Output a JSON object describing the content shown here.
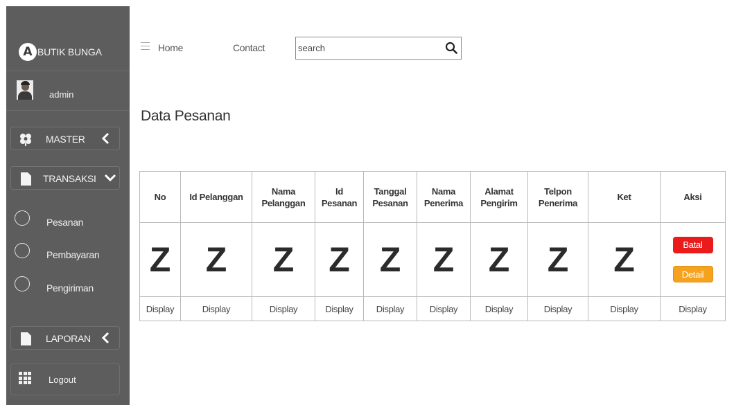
{
  "sidebar": {
    "brand": {
      "logo_letter": "A",
      "name": "BUTIK BUNGA"
    },
    "user": {
      "name": "admin"
    },
    "master": {
      "label": "MASTER"
    },
    "transaksi": {
      "label": "TRANSAKSI",
      "items": [
        {
          "label": "Pesanan"
        },
        {
          "label": "Pembayaran"
        },
        {
          "label": "Pengiriman"
        }
      ]
    },
    "laporan": {
      "label": "LAPORAN"
    },
    "logout": {
      "label": "Logout"
    }
  },
  "topnav": {
    "home": "Home",
    "contact": "Contact",
    "search_value": "search"
  },
  "page": {
    "title": "Data Pesanan"
  },
  "table": {
    "headers": [
      {
        "line1": "No",
        "line2": ""
      },
      {
        "line1": "Id Pelanggan",
        "line2": ""
      },
      {
        "line1": "Nama",
        "line2": "Pelanggan"
      },
      {
        "line1": "Id",
        "line2": "Pesanan"
      },
      {
        "line1": "Tanggal",
        "line2": "Pesanan"
      },
      {
        "line1": "Nama",
        "line2": "Penerima"
      },
      {
        "line1": "Alamat",
        "line2": "Pengirim"
      },
      {
        "line1": "Telpon",
        "line2": "Penerima"
      },
      {
        "line1": "Ket",
        "line2": ""
      },
      {
        "line1": "Aksi",
        "line2": ""
      }
    ],
    "placeholder_glyph": "Z",
    "display_label": "Display",
    "actions": {
      "cancel": "Batal",
      "detail": "Detail"
    }
  },
  "colors": {
    "sidebar_bg": "#5d5d5d",
    "cancel_button": "#ea1b1b",
    "detail_button": "#f5a21f"
  }
}
